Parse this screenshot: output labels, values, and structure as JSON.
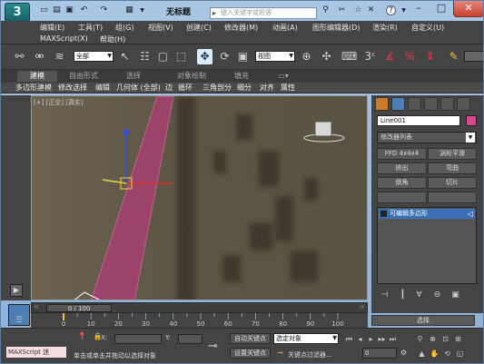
{
  "titlebar": {
    "app_logo": "3",
    "title": "无标题",
    "search_placeholder": "键入关键字或短语",
    "quick_access": [
      "new-icon",
      "open-icon",
      "save-icon",
      "undo-icon",
      "redo-icon",
      "project-icon"
    ],
    "help_label": "?"
  },
  "menubar": {
    "row1": [
      "编辑(E)",
      "工具(T)",
      "组(G)",
      "视图(V)",
      "创建(C)",
      "修改器(M)",
      "动画(A)",
      "图形编辑器(D)",
      "渲染(R)",
      "自定义(U)"
    ],
    "row2": [
      "MAXScript(X)",
      "帮助(H)"
    ]
  },
  "toolbar": {
    "selection_filter": "全部",
    "ref_coord": "视图",
    "create_selection_set": ""
  },
  "ribbon": {
    "tabs": [
      "建模",
      "自由形式",
      "选择",
      "对象绘制",
      "填充"
    ],
    "active_tab": "建模",
    "bar_items": [
      "多边形建模",
      "修改选择",
      "编辑",
      "几何体 (全部)",
      "边",
      "循环",
      "三角剖分",
      "细分",
      "对齐",
      "属性"
    ]
  },
  "viewport": {
    "label": "[+] [正交] [真实]"
  },
  "command_panel": {
    "object_name": "Line001",
    "object_color": "#d9478a",
    "modifier_list": "修改器列表",
    "buttons": [
      "FFD 4x4x4",
      "涡轮平滑",
      "挤出",
      "弯曲",
      "倒角",
      "切片"
    ],
    "stack_item": "可编辑多边形",
    "selection_label": "选择"
  },
  "timeline": {
    "frame": "0 / 100",
    "ticks": [
      "0",
      "10",
      "20",
      "30",
      "40",
      "50",
      "60",
      "70",
      "80",
      "90",
      "100"
    ]
  },
  "status": {
    "maxscript_label": "MAXScript 迷",
    "prompt": "单击或单击并拖动以选择对象",
    "x_label": "X:",
    "y_label": "Y:",
    "x_value": "",
    "y_value": "",
    "auto_key": "自动关键点",
    "set_key": "设置关键点",
    "selected_dropdown": "选定对象",
    "key_filters": "关键点过滤器...",
    "frame_input": "0"
  }
}
